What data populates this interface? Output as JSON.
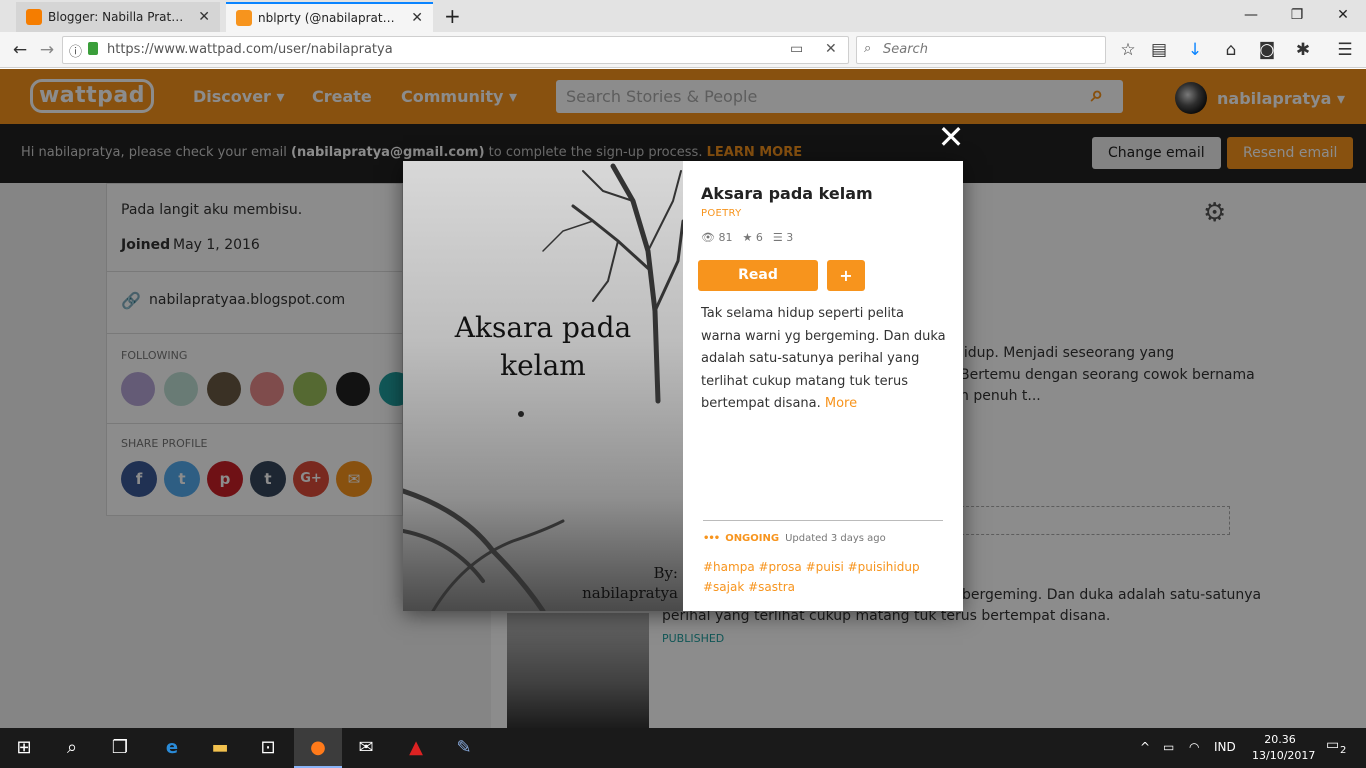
{
  "browser": {
    "tabs": [
      {
        "label": "Blogger: Nabilla Pratya Aug",
        "favicon_color": "#f57d00",
        "active": false
      },
      {
        "label": "nblprty (@nabilapratya) - W",
        "favicon_color": "#f7941d",
        "active": true
      }
    ],
    "new_tab": "+",
    "window_controls": {
      "minimize": "—",
      "restore": "❐",
      "close": "✕"
    },
    "url": "https://www.wattpad.com/user/nabilapratya",
    "search_placeholder": "Search"
  },
  "wattpad": {
    "logo": "wattpad",
    "nav": {
      "discover": "Discover ▾",
      "create": "Create",
      "community": "Community ▾"
    },
    "search_placeholder": "Search Stories & People",
    "username": "nabilapratya ▾"
  },
  "notice": {
    "prefix": "Hi nabilapratya, please check your email ",
    "email": "(nabilapratya@gmail.com)",
    "suffix": " to complete the sign-up process. ",
    "learn_more": "LEARN MORE",
    "change_email": "Change email",
    "resend_email": "Resend email"
  },
  "profile": {
    "bio": "Pada langit aku membisu.",
    "joined_label": "Joined",
    "joined_date": "May 1, 2016",
    "website": "nabilapratyaa.blogspot.com",
    "following_label": "FOLLOWING",
    "share_label": "SHARE PROFILE",
    "share_icons": {
      "facebook": "f",
      "twitter": "t",
      "pinterest": "p",
      "tumblr": "t",
      "googleplus": "G+",
      "email": "✉"
    }
  },
  "background_story": {
    "snippet1": "hidup. Menjadi seseorang yang",
    "snippet2": "Bertemu dengan seorang cowok bernama",
    "snippet3": "n penuh t...",
    "snippet4": "bergeming. Dan duka adalah satu-satunya",
    "snippet5": "perihal yang terlihat cukup matang tuk terus bertempat disana.",
    "published": "PUBLISHED"
  },
  "modal": {
    "close": "✕",
    "cover_title": "Aksara pada kelam",
    "cover_author": "By: nabilapratya",
    "title": "Aksara pada kelam",
    "genre": "POETRY",
    "reads": "81",
    "votes": "6",
    "parts": "3",
    "read_button": "Read",
    "add_button": "+",
    "description": "Tak selama hidup seperti pelita warna warni yg bergeming. Dan duka adalah satu-satunya perihal yang terlihat cukup matang tuk terus bertempat disana. ",
    "more": "More",
    "status": "ONGOING",
    "updated": "Updated 3 days ago",
    "tags": "#hampa #prosa #puisi #puisihidup #sajak #sastra"
  },
  "taskbar": {
    "lang": "IND",
    "time": "20.36",
    "date": "13/10/2017",
    "notifications": "2"
  },
  "colors": {
    "accent": "#f7941d",
    "dark": "#222222"
  }
}
